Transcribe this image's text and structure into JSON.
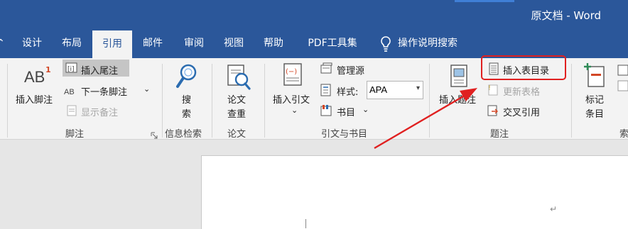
{
  "window": {
    "title": "原文档 - Word"
  },
  "tabs": [
    "设计",
    "布局",
    "引用",
    "邮件",
    "审阅",
    "视图",
    "帮助",
    "PDF工具集"
  ],
  "tellme": "操作说明搜索",
  "footnote": {
    "insert_footnote": "插入脚注",
    "insert_endnote": "插入尾注",
    "next_footnote": "下一条脚注",
    "show_notes": "显示备注",
    "group": "脚注",
    "ab_glyph": "AB",
    "ab_sup": "1",
    "ab_small": "AB"
  },
  "research": {
    "search_l1": "搜",
    "search_l2": "索",
    "group": "信息检索"
  },
  "paper": {
    "check_l1": "论文",
    "check_l2": "查重",
    "group": "论文"
  },
  "citations": {
    "insert_citation": "插入引文",
    "manage_sources": "管理源",
    "style_label": "样式:",
    "style_value": "APA",
    "bibliography": "书目",
    "group": "引文与书目"
  },
  "captions": {
    "insert_caption": "插入题注",
    "insert_tof": "插入表目录",
    "update_table": "更新表格",
    "cross_reference": "交叉引用",
    "group": "题注"
  },
  "index": {
    "mark_l1": "标记",
    "mark_l2": "条目",
    "group_partial": "索"
  },
  "document": {
    "para_mark": "↵"
  },
  "colors": {
    "brand": "#2b579a",
    "annotation": "#e02020"
  }
}
